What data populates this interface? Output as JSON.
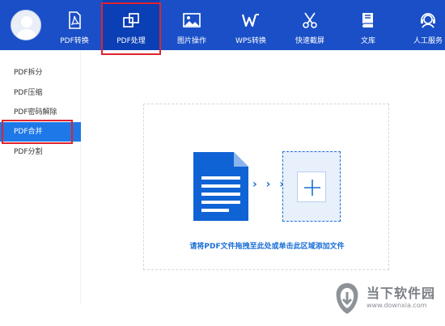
{
  "toolbar": {
    "items": [
      {
        "label": "PDF转换",
        "icon": "pdf-document-icon"
      },
      {
        "label": "PDF处理",
        "icon": "overlapping-squares-icon"
      },
      {
        "label": "图片操作",
        "icon": "picture-icon"
      },
      {
        "label": "WPS转换",
        "icon": "wps-logo-icon"
      },
      {
        "label": "快速截屏",
        "icon": "scissors-icon"
      },
      {
        "label": "文库",
        "icon": "book-icon"
      },
      {
        "label": "人工服务",
        "icon": "headset-icon"
      }
    ],
    "active_index": 1
  },
  "sidebar": {
    "items": [
      {
        "label": "PDF拆分"
      },
      {
        "label": "PDF压缩"
      },
      {
        "label": "PDF密码解除"
      },
      {
        "label": "PDF合并"
      },
      {
        "label": "PDF分割"
      }
    ],
    "active_index": 3
  },
  "dropzone": {
    "arrows": "› › ›",
    "hint": "请将PDF文件拖拽至此处或单击此区域添加文件"
  },
  "watermark": {
    "title": "当下软件园",
    "url": "www.downxia.com"
  },
  "colors": {
    "toolbar_bg": "#1a4fc7",
    "accent": "#1f78e8",
    "highlight_outline": "#e0232e"
  }
}
